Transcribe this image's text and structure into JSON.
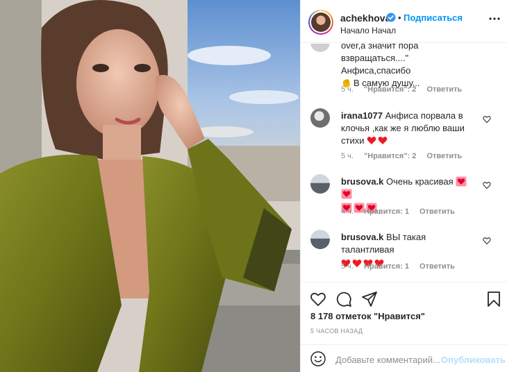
{
  "post": {
    "username": "achekhova",
    "follow_label": "Подписаться",
    "dot": "•",
    "location": "Начало Начал"
  },
  "comments": [
    {
      "username": "",
      "text_line1": "over,а значит пора",
      "text_line2": "взвращаться....\" Анфиса,спасибо",
      "text_line3": "В самую душу...",
      "time": "5 ч.",
      "likes": "\"Нравится\": 2",
      "reply": "Ответить"
    },
    {
      "username": "irana1077",
      "text_line1": "Анфиса порвала в",
      "text_line2": "клочья ,как же я люблю ваши",
      "text_line3": "стихи",
      "time": "5 ч.",
      "likes": "\"Нравится\": 2",
      "reply": "Ответить"
    },
    {
      "username": "brusova.k",
      "text_line1": "Очень красивая",
      "time": "4 ч.",
      "likes": "Нравится: 1",
      "reply": "Ответить"
    },
    {
      "username": "brusova.k",
      "text_line1": "ВЫ такая талантливая",
      "time": "5 ч.",
      "likes": "Нравится: 1",
      "reply": "Ответить"
    }
  ],
  "footer": {
    "likes_count": "8 178 отметок \"Нравится\"",
    "posted_time": "5 ЧАСОВ НАЗАД",
    "comment_placeholder": "Добавьте комментарий...",
    "publish_label": "Опубликовать"
  },
  "colors": {
    "accent_blue": "#0095f6",
    "publish_disabled": "#b2dffc",
    "heart_red": "#ed1c24",
    "muted": "#8e8e8e"
  },
  "icons": {
    "header": [
      "verified-badge-icon",
      "more-options-icon"
    ],
    "actions": [
      "like-icon",
      "comment-icon",
      "share-icon",
      "save-icon"
    ],
    "comment": [
      "comment-like-icon",
      "clap-emoji",
      "heart-emoji",
      "heart-box-emoji"
    ],
    "input": [
      "emoji-smile-icon"
    ]
  }
}
